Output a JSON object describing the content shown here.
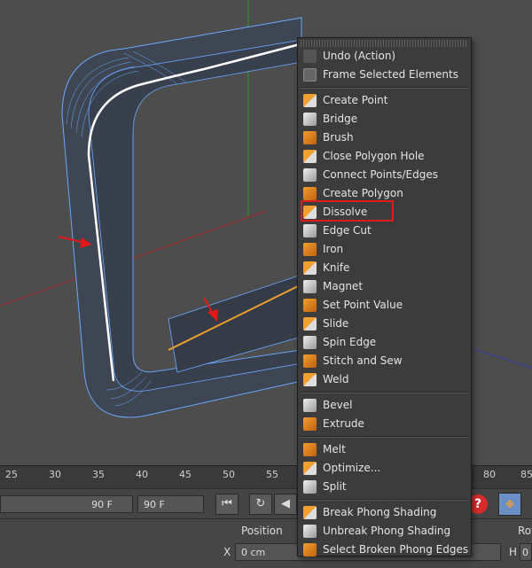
{
  "menu": {
    "groups": [
      [
        {
          "label": "Undo (Action)",
          "icon": "undo-icon"
        },
        {
          "label": "Frame Selected Elements",
          "icon": "frame-icon"
        }
      ],
      [
        {
          "label": "Create Point",
          "icon": "create-point-icon"
        },
        {
          "label": "Bridge",
          "icon": "bridge-icon"
        },
        {
          "label": "Brush",
          "icon": "brush-icon"
        },
        {
          "label": "Close Polygon Hole",
          "icon": "close-polygon-hole-icon"
        },
        {
          "label": "Connect Points/Edges",
          "icon": "connect-icon"
        },
        {
          "label": "Create Polygon",
          "icon": "create-polygon-icon"
        },
        {
          "label": "Dissolve",
          "icon": "dissolve-icon"
        },
        {
          "label": "Edge Cut",
          "icon": "edge-cut-icon"
        },
        {
          "label": "Iron",
          "icon": "iron-icon"
        },
        {
          "label": "Knife",
          "icon": "knife-icon"
        },
        {
          "label": "Magnet",
          "icon": "magnet-icon"
        },
        {
          "label": "Set Point Value",
          "icon": "set-point-value-icon"
        },
        {
          "label": "Slide",
          "icon": "slide-icon"
        },
        {
          "label": "Spin Edge",
          "icon": "spin-edge-icon"
        },
        {
          "label": "Stitch and Sew",
          "icon": "stitch-icon"
        },
        {
          "label": "Weld",
          "icon": "weld-icon"
        }
      ],
      [
        {
          "label": "Bevel",
          "icon": "bevel-icon"
        },
        {
          "label": "Extrude",
          "icon": "extrude-icon"
        }
      ],
      [
        {
          "label": "Melt",
          "icon": "melt-icon"
        },
        {
          "label": "Optimize...",
          "icon": "optimize-icon"
        },
        {
          "label": "Split",
          "icon": "split-icon"
        }
      ],
      [
        {
          "label": "Break Phong Shading",
          "icon": "break-phong-icon"
        },
        {
          "label": "Unbreak Phong Shading",
          "icon": "unbreak-phong-icon"
        },
        {
          "label": "Select Broken Phong Edges",
          "icon": "select-phong-icon"
        }
      ]
    ],
    "highlighted": "Dissolve"
  },
  "timeline": {
    "ticks": [
      "25",
      "30",
      "35",
      "40",
      "45",
      "50",
      "55",
      "80",
      "85"
    ]
  },
  "controls": {
    "end_frame_field": "90 F",
    "end_frame_field2": "90 F"
  },
  "attributes": {
    "position_label": "Position",
    "x_label": "X",
    "x_value": "0 cm",
    "h_label": "H",
    "h_value": "0",
    "rot_label": "Rot"
  },
  "colors": {
    "accent_orange": "#f0a030",
    "highlight_red": "#e01a1a",
    "wire_blue": "#6aa8ff"
  }
}
